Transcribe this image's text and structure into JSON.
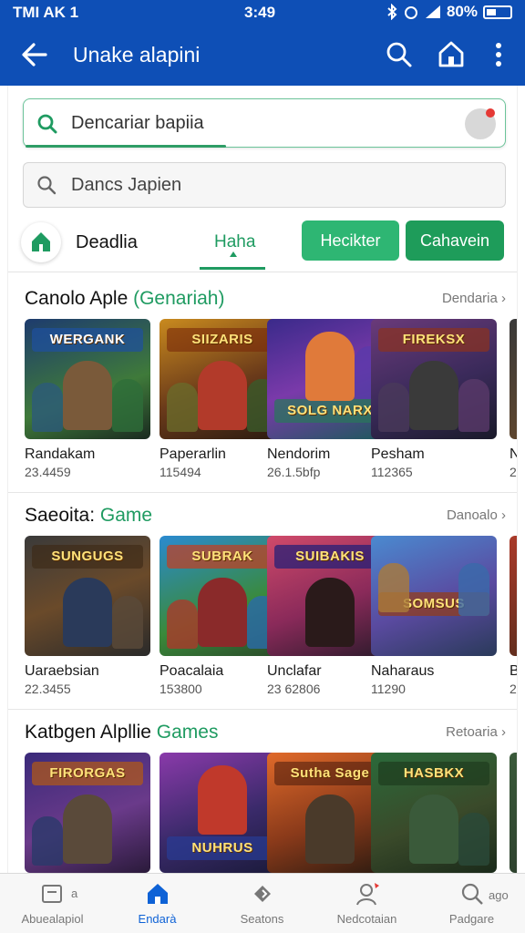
{
  "status_bar": {
    "carrier": "TMI AK 1",
    "time": "3:49",
    "battery": "80%"
  },
  "app_bar": {
    "title": "Unake alapini",
    "back_icon": "back-arrow-icon",
    "actions": [
      "search-icon",
      "home-icon",
      "more-vert-icon"
    ]
  },
  "search_primary": {
    "placeholder": "Dencariar bapiia"
  },
  "search_secondary": {
    "placeholder": "Dancs Japien"
  },
  "tabs": {
    "first_label": "Deadlia",
    "active_label": "Haha",
    "pill_1": "Hecikter",
    "pill_2": "Cahavein"
  },
  "sections": [
    {
      "title_main": "Canolo Aple ",
      "title_accent": "(Genariah)",
      "more_label": "Dendaria",
      "cards": [
        {
          "logo": "WERGANK",
          "name": "Randakam",
          "size": "23.4459"
        },
        {
          "logo": "SIIZARIS",
          "name": "Paperarlin",
          "size": "115494"
        },
        {
          "logo": "SOLG NARX",
          "name": "Nendorim",
          "size": "26.1.5bfp"
        },
        {
          "logo": "FIREKSX",
          "name": "Pesham",
          "size": "112365"
        },
        {
          "logo": "",
          "name": "Ne",
          "size": "2"
        }
      ]
    },
    {
      "title_main": "Saeoita:",
      "title_accent": "Game",
      "more_label": "Danoalo",
      "cards": [
        {
          "logo": "SUNGUGS",
          "name": "Uaraebsian",
          "size": "22.3455"
        },
        {
          "logo": "SUBRAK",
          "name": "Poacalaia",
          "size": "153800"
        },
        {
          "logo": "SUIBAKIS",
          "name": "Unclafar",
          "size": "23 62806"
        },
        {
          "logo": "SOMSUS",
          "name": "Naharaus",
          "size": "11290"
        },
        {
          "logo": "",
          "name": "Be",
          "size": "2"
        }
      ]
    },
    {
      "title_main": "Katbgen Alpllie",
      "title_accent": "Games",
      "more_label": "Retoaria",
      "cards": [
        {
          "logo": "FIRORGAS",
          "name": "",
          "size": ""
        },
        {
          "logo": "NUHRUS",
          "name": "",
          "size": ""
        },
        {
          "logo": "Sutha Sage",
          "name": "",
          "size": ""
        },
        {
          "logo": "HASBKX",
          "name": "",
          "size": ""
        }
      ]
    }
  ],
  "bottom_nav": [
    {
      "label": "Abuealapiol",
      "badge": "a",
      "icon": "library-icon"
    },
    {
      "label": "Endarà",
      "icon": "home-icon",
      "active": true
    },
    {
      "label": "Seatons",
      "icon": "games-icon"
    },
    {
      "label": "Nedcotaian",
      "icon": "account-icon"
    },
    {
      "label": "Padgare",
      "badge": "ago",
      "icon": "search-icon"
    }
  ],
  "colors": {
    "primary": "#0e4fb6",
    "accent_green": "#1f9b61",
    "pill_green": "#2eb673",
    "nav_active": "#0e62d6"
  }
}
